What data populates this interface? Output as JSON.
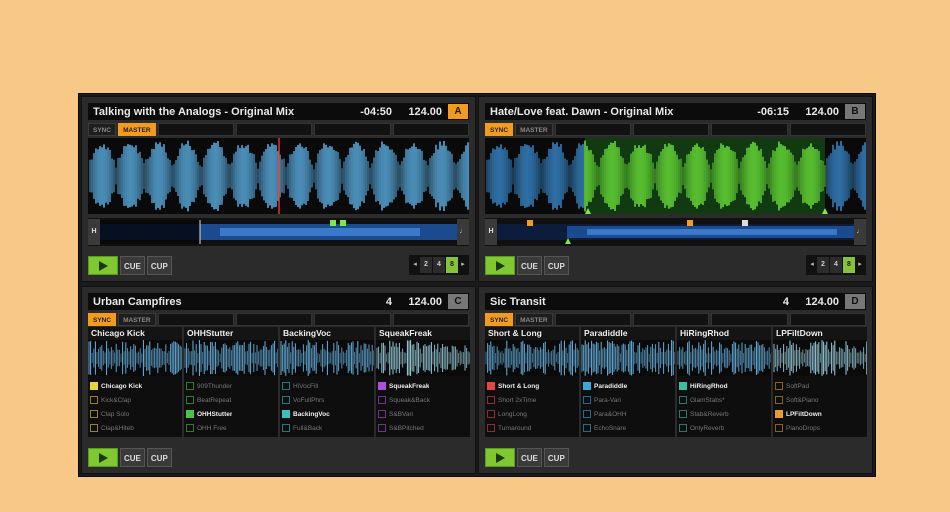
{
  "decks": [
    {
      "id": "A",
      "title": "Talking with the Analogs - Original Mix",
      "time": "-04:50",
      "bpm": "124.00",
      "letter": "A",
      "letter_active": true,
      "sync_label": "SYNC",
      "master_label": "MASTER",
      "sync_on": false,
      "master_on": true,
      "waveform_color": "#5fb8f0",
      "overview_start": "H",
      "overview_end": "♩",
      "cue_label": "CUE",
      "cup_label": "CUP",
      "loop": {
        "sizes": [
          "2",
          "4",
          "8"
        ],
        "selected": "8"
      }
    },
    {
      "id": "B",
      "title": "Hate/Love feat. Dawn - Original Mix",
      "time": "-06:15",
      "bpm": "124.00",
      "letter": "B",
      "letter_active": false,
      "sync_label": "SYNC",
      "master_label": "MASTER",
      "sync_on": true,
      "master_on": false,
      "waveform_color": "#3a8fd6",
      "overview_start": "H",
      "overview_end": "♩",
      "cue_label": "CUE",
      "cup_label": "CUP",
      "loop": {
        "sizes": [
          "2",
          "4",
          "8"
        ],
        "selected": "8"
      }
    },
    {
      "id": "C",
      "title": "Urban Campfires",
      "beats": "4",
      "bpm": "124.00",
      "letter": "C",
      "sync_label": "SYNC",
      "master_label": "MASTER",
      "sync_on": true,
      "master_on": false,
      "cue_label": "CUE",
      "cup_label": "CUP",
      "slots": [
        {
          "name": "Chicago Kick",
          "color": "#e8d23a",
          "cells": [
            "Chicago Kick",
            "Kick&Clap",
            "Clap Solo",
            "Clap&Hiteb"
          ],
          "active": 0
        },
        {
          "name": "OHHStutter",
          "color": "#4cc04c",
          "cells": [
            "909Thunder",
            "BeatRepeat",
            "OHHStutter",
            "OHH Free"
          ],
          "active": 2
        },
        {
          "name": "BackingVoc",
          "color": "#3ac0c0",
          "cells": [
            "HiVocFill",
            "VoFullPhrs",
            "BackingVoc",
            "Full&Back"
          ],
          "active": 2
        },
        {
          "name": "SqueakFreak",
          "color": "#b050d8",
          "cells": [
            "SqueakFreak",
            "Squeak&Back",
            "S&BVari",
            "S&BPitched"
          ],
          "active": 0
        }
      ]
    },
    {
      "id": "D",
      "title": "Sic Transit",
      "beats": "4",
      "bpm": "124.00",
      "letter": "D",
      "sync_label": "SYNC",
      "master_label": "MASTER",
      "sync_on": true,
      "master_on": false,
      "cue_label": "CUE",
      "cup_label": "CUP",
      "slots": [
        {
          "name": "Short & Long",
          "color": "#e04848",
          "cells": [
            "Short & Long",
            "Short 2xTime",
            "LongLong",
            "Turnaround"
          ],
          "active": 0
        },
        {
          "name": "Paradiddle",
          "color": "#3aa8d8",
          "cells": [
            "Paradiddle",
            "Para-Vari",
            "Para&OHH",
            "EchoSnare"
          ],
          "active": 0
        },
        {
          "name": "HiRingRhod",
          "color": "#3ac0a0",
          "cells": [
            "HiRingRhod",
            "GlamStabs*",
            "Stab&Reverb",
            "OnlyReverb"
          ],
          "active": 0
        },
        {
          "name": "LPFiltDown",
          "color": "#e89a2a",
          "cells": [
            "SoftPad",
            "Soft&Piano",
            "LPFiltDown",
            "PianoDrops"
          ],
          "active": 2
        }
      ]
    }
  ]
}
